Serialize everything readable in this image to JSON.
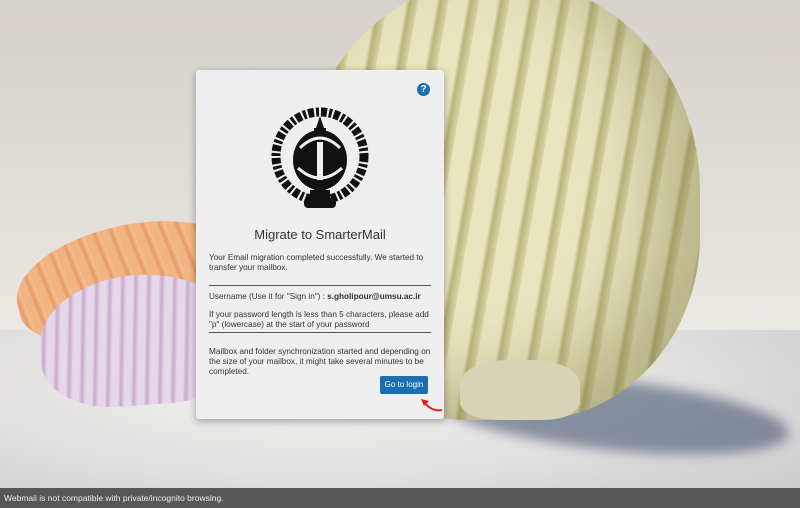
{
  "dialog": {
    "title": "Migrate to SmarterMail",
    "help_icon": "?",
    "message_success": "Your Email migration completed successfully. We started to transfer your mailbox.",
    "username_label": "Username (Use it for \"Sign in\") : ",
    "username_value": "s.gholipour@umsu.ac.ir",
    "password_note": "If your password length is less than 5 characters, please add \"p\" (lowercase) at the start of your password",
    "sync_note": "Mailbox and folder synchronization started and depending on the size of your mailbox, it might take several minutes to be completed.",
    "button_label": "Go to login"
  },
  "footer": {
    "text": "Webmail is not compatible with private/incognito browsing."
  },
  "colors": {
    "accent": "#1a6fb1",
    "footer_bg": "#575757",
    "annotation_arrow": "#e02020"
  },
  "icons": {
    "help": "question-circle-icon",
    "logo": "university-emblem-logo",
    "arrow": "red-arrow-annotation"
  }
}
